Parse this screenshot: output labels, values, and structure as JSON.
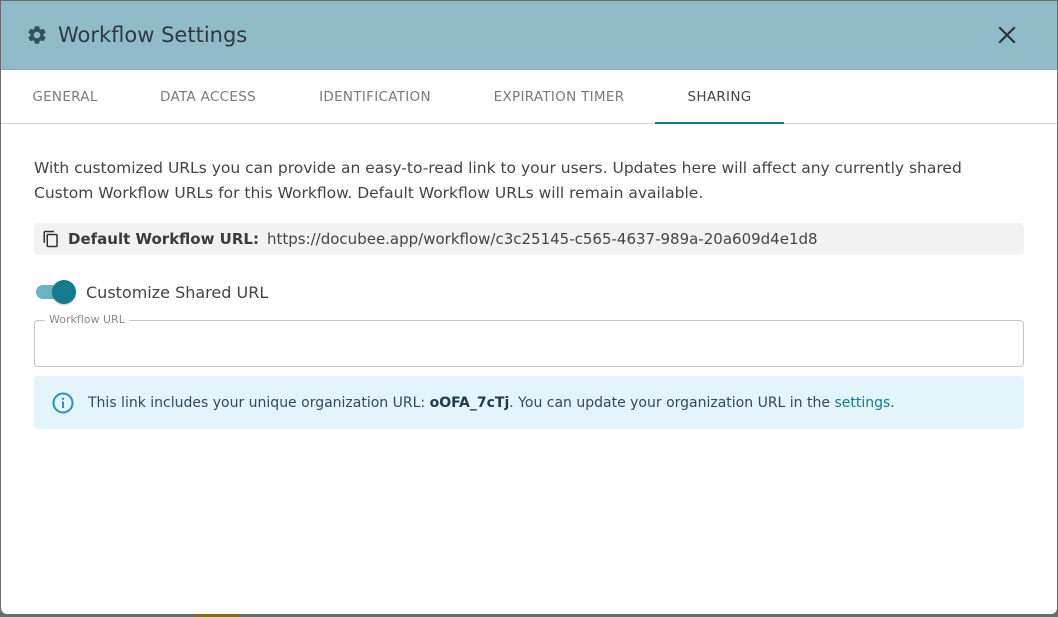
{
  "dialog": {
    "title": "Workflow Settings",
    "title_icon": "gear-icon",
    "close_icon": "close-icon"
  },
  "tabs": [
    {
      "label": "GENERAL",
      "active": false
    },
    {
      "label": "DATA ACCESS",
      "active": false
    },
    {
      "label": "IDENTIFICATION",
      "active": false
    },
    {
      "label": "EXPIRATION TIMER",
      "active": false
    },
    {
      "label": "SHARING",
      "active": true
    }
  ],
  "sharing": {
    "intro": "With customized URLs you can provide an easy-to-read link to your users. Updates here will affect any currently shared Custom Workflow URLs for this Workflow. Default Workflow URLs will remain available.",
    "default_url_label": "Default Workflow URL:",
    "default_url_value": "https://docubee.app/workflow/c3c25145-c565-4637-989a-20a609d4e1d8",
    "copy_icon": "copy-icon",
    "toggle_label": "Customize Shared URL",
    "toggle_on": true,
    "workflow_url_label": "Workflow URL",
    "workflow_url_value": "",
    "info": {
      "icon": "info-icon",
      "text_before": "This link includes your unique organization URL: ",
      "org_url": "oOFA_7cTj",
      "text_middle": ". You can update your organization URL in the ",
      "link_text": "settings",
      "text_after": "."
    }
  },
  "colors": {
    "header_bg": "#8fbcc8",
    "accent": "#137a8f",
    "info_bg": "#e3f4fb"
  }
}
